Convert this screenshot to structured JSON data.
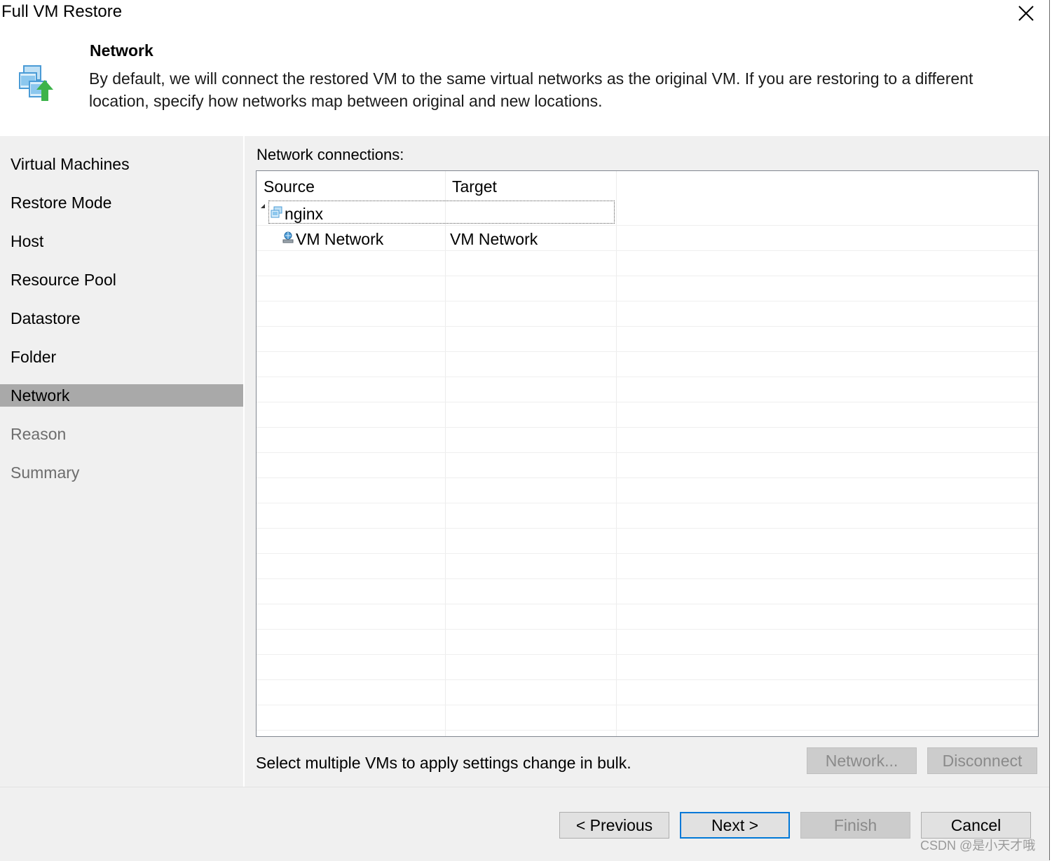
{
  "window": {
    "title": "Full VM Restore"
  },
  "header": {
    "title": "Network",
    "description": "By default, we will connect the restored VM to the same virtual networks as the original VM. If you are restoring to a different location, specify how networks map between original and new locations."
  },
  "sidebar": {
    "items": [
      {
        "label": "Virtual Machines",
        "state": "normal"
      },
      {
        "label": "Restore Mode",
        "state": "normal"
      },
      {
        "label": "Host",
        "state": "normal"
      },
      {
        "label": "Resource Pool",
        "state": "normal"
      },
      {
        "label": "Datastore",
        "state": "normal"
      },
      {
        "label": "Folder",
        "state": "normal"
      },
      {
        "label": "Network",
        "state": "active"
      },
      {
        "label": "Reason",
        "state": "disabled"
      },
      {
        "label": "Summary",
        "state": "disabled"
      }
    ]
  },
  "main": {
    "section_label": "Network connections:",
    "columns": [
      "Source",
      "Target"
    ],
    "rows": [
      {
        "source": "nginx",
        "target": "",
        "icon": "vm-icon",
        "expanded": true
      },
      {
        "source": "VM Network",
        "target": "VM Network",
        "icon": "network-icon"
      }
    ],
    "hint": "Select multiple VMs to apply settings change in bulk.",
    "network_button": "Network...",
    "disconnect_button": "Disconnect"
  },
  "footer": {
    "previous": "< Previous",
    "next": "Next >",
    "finish": "Finish",
    "cancel": "Cancel"
  },
  "watermark": "CSDN @是小天才哦",
  "colors": {
    "panel_bg": "#f0f0f0",
    "active_nav": "#a9a9a9",
    "default_button_border": "#0078d7",
    "icon_green": "#3db34a",
    "icon_blue": "#4a9bd6"
  }
}
